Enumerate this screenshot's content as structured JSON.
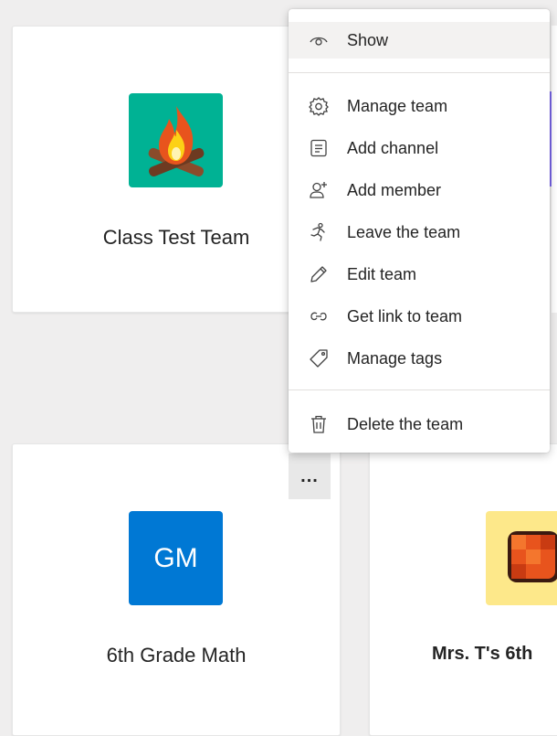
{
  "cards": {
    "class_test_team": {
      "name": "Class Test Team",
      "avatar_color": "#00b294"
    },
    "grade_math": {
      "name": "6th Grade Math",
      "initials": "GM",
      "avatar_color": "#0078d4"
    },
    "mrs_t": {
      "name": "Mrs. T's 6th",
      "avatar_color": "#fce100"
    }
  },
  "menu": {
    "items": [
      {
        "label": "Show",
        "icon": "eye-icon"
      },
      {
        "label": "Manage team",
        "icon": "gear-icon"
      },
      {
        "label": "Add channel",
        "icon": "channel-icon"
      },
      {
        "label": "Add member",
        "icon": "add-person-icon"
      },
      {
        "label": "Leave the team",
        "icon": "running-person-icon"
      },
      {
        "label": "Edit team",
        "icon": "pencil-icon"
      },
      {
        "label": "Get link to team",
        "icon": "link-icon"
      },
      {
        "label": "Manage tags",
        "icon": "tag-icon"
      },
      {
        "label": "Delete the team",
        "icon": "trash-icon"
      }
    ]
  },
  "more_options": {
    "label": "..."
  },
  "colors": {
    "accent_purple": "#7b68ee",
    "menu_hover": "#f3f2f1"
  }
}
